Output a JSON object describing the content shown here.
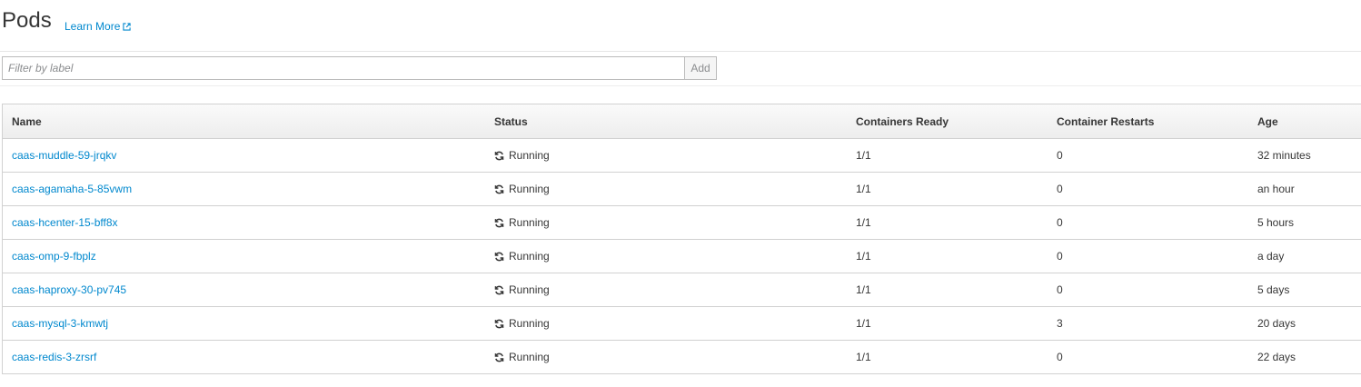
{
  "header": {
    "title": "Pods",
    "learn_more": "Learn More"
  },
  "filter": {
    "placeholder": "Filter by label",
    "add_label": "Add"
  },
  "table": {
    "columns": {
      "name": "Name",
      "status": "Status",
      "ready": "Containers Ready",
      "restarts": "Container Restarts",
      "age": "Age"
    },
    "rows": [
      {
        "name": "caas-muddle-59-jrqkv",
        "status": "Running",
        "ready": "1/1",
        "restarts": "0",
        "age": "32 minutes"
      },
      {
        "name": "caas-agamaha-5-85vwm",
        "status": "Running",
        "ready": "1/1",
        "restarts": "0",
        "age": "an hour"
      },
      {
        "name": "caas-hcenter-15-bff8x",
        "status": "Running",
        "ready": "1/1",
        "restarts": "0",
        "age": "5 hours"
      },
      {
        "name": "caas-omp-9-fbplz",
        "status": "Running",
        "ready": "1/1",
        "restarts": "0",
        "age": "a day"
      },
      {
        "name": "caas-haproxy-30-pv745",
        "status": "Running",
        "ready": "1/1",
        "restarts": "0",
        "age": "5 days"
      },
      {
        "name": "caas-mysql-3-kmwtj",
        "status": "Running",
        "ready": "1/1",
        "restarts": "3",
        "age": "20 days"
      },
      {
        "name": "caas-redis-3-zrsrf",
        "status": "Running",
        "ready": "1/1",
        "restarts": "0",
        "age": "22 days"
      }
    ]
  },
  "colors": {
    "link": "#0088ce",
    "text": "#363636",
    "border": "#d1d1d1"
  },
  "icons": {
    "external": "external-link-icon",
    "status": "sync-icon"
  }
}
